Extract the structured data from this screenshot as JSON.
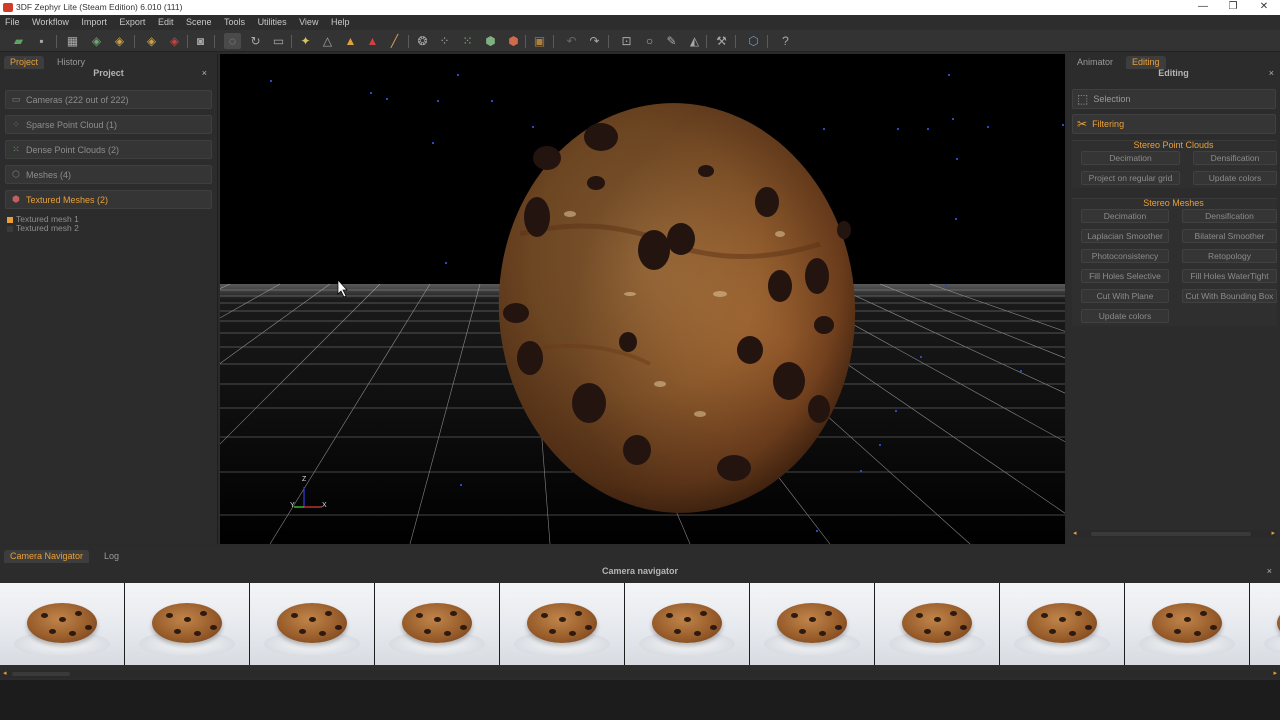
{
  "window": {
    "title": "3DF Zephyr Lite (Steam Edition) 6.010 (111)"
  },
  "menu": [
    "File",
    "Workflow",
    "Import",
    "Export",
    "Edit",
    "Scene",
    "Tools",
    "Utilities",
    "View",
    "Help"
  ],
  "toolbar": {
    "help_glyph": "?"
  },
  "left_panel": {
    "tabs": [
      "Project",
      "History"
    ],
    "header": "Project",
    "close_glyph": "×",
    "items": [
      {
        "label": "Cameras (222 out of 222)",
        "icon": "camera-icon"
      },
      {
        "label": "Sparse Point Cloud (1)",
        "icon": "point-cloud-icon"
      },
      {
        "label": "Dense Point Clouds (2)",
        "icon": "dense-cloud-icon"
      },
      {
        "label": "Meshes (4)",
        "icon": "mesh-icon"
      },
      {
        "label": "Textured Meshes (2)",
        "icon": "textured-mesh-icon"
      }
    ],
    "textured_meshes": [
      {
        "label": "Textured mesh 1",
        "color": "#e8a03a"
      },
      {
        "label": "Textured mesh 2",
        "color": "#3a3a3a"
      }
    ]
  },
  "viewport": {
    "axes": {
      "z": "Z",
      "y": "Y",
      "x": "X"
    }
  },
  "right_panel": {
    "tabs": [
      "Animator",
      "Editing"
    ],
    "header": "Editing",
    "close_glyph": "×",
    "sections": [
      {
        "label": "Selection",
        "icon": "selection-icon"
      },
      {
        "label": "Filtering",
        "icon": "filtering-icon"
      }
    ],
    "stereo_point_clouds": {
      "title": "Stereo Point Clouds",
      "buttons": [
        "Decimation",
        "Densification",
        "Project on regular grid",
        "Update colors"
      ]
    },
    "stereo_meshes": {
      "title": "Stereo Meshes",
      "buttons": [
        "Decimation",
        "Densification",
        "Laplacian Smoother",
        "Bilateral Smoother",
        "Photoconsistency",
        "Retopology",
        "Fill Holes Selective",
        "Fill Holes WaterTight",
        "Cut With Plane",
        "Cut With Bounding Box",
        "Update colors"
      ]
    }
  },
  "bottom_panel": {
    "tabs": [
      "Camera Navigator",
      "Log"
    ],
    "header": "Camera navigator",
    "close_glyph": "×",
    "thumbnail_count": 11
  },
  "colors": {
    "accent": "#e8a03a",
    "panel": "#2c2c2c",
    "viewport": "#000000"
  }
}
